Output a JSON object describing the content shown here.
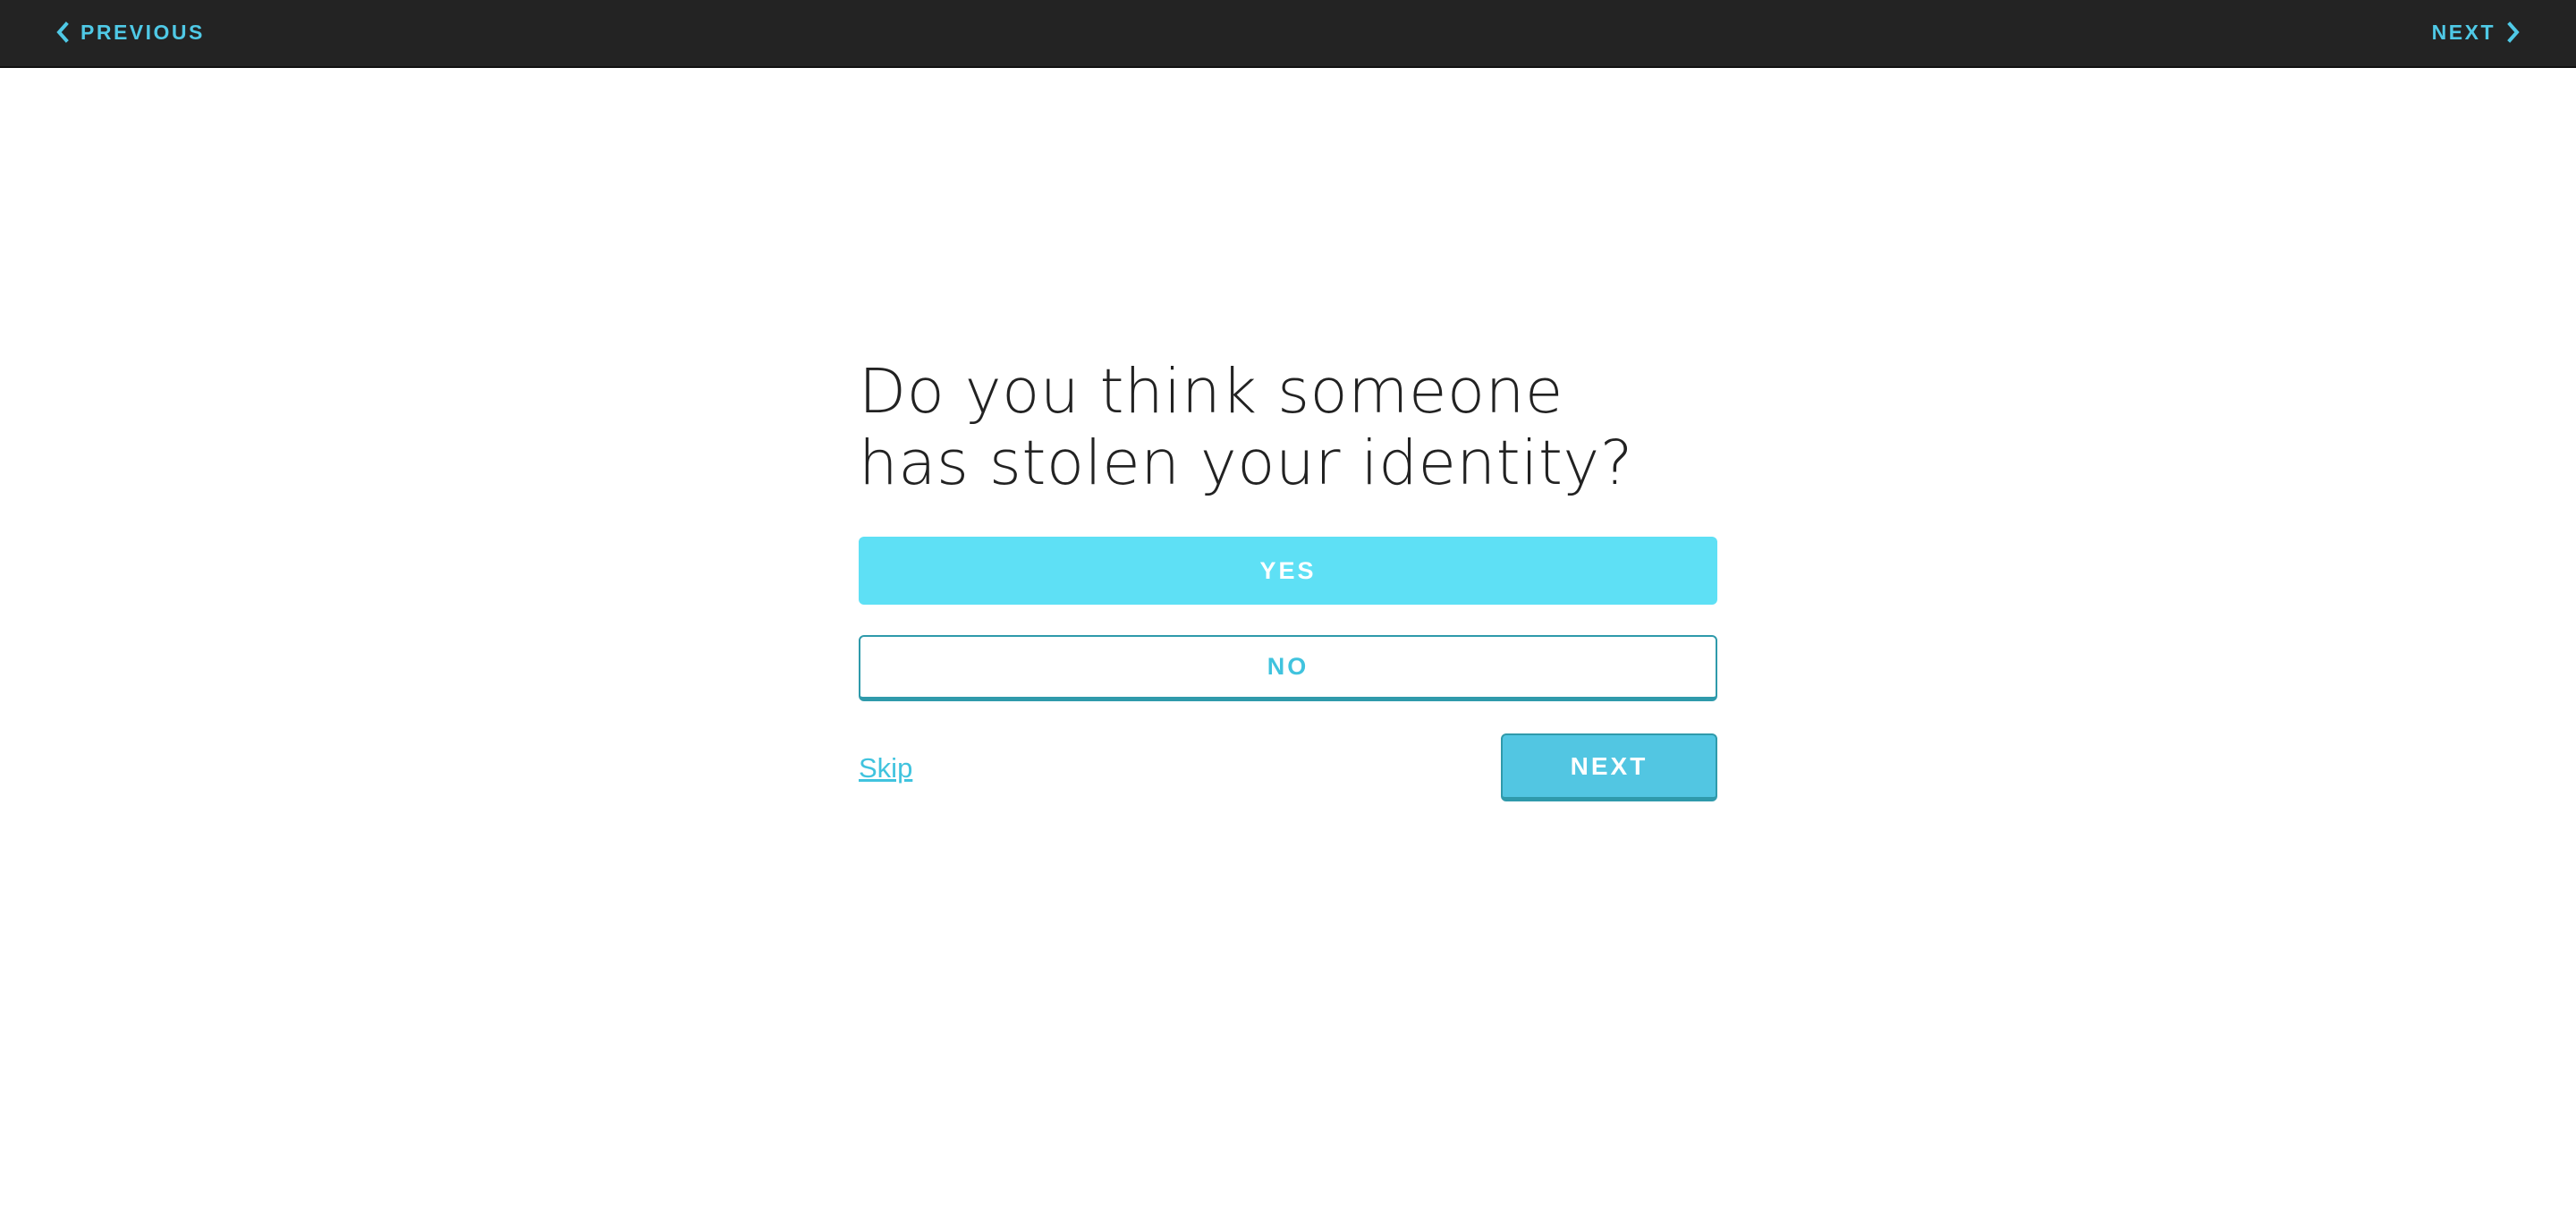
{
  "topbar": {
    "previous_label": "PREVIOUS",
    "next_label": "NEXT",
    "previous_icon": "chevron-left-icon",
    "next_icon": "chevron-right-icon"
  },
  "question": {
    "line1": "Do you think someone",
    "line2": "has stolen your identity?"
  },
  "answers": {
    "yes_label": "YES",
    "no_label": "NO"
  },
  "actions": {
    "skip_label": "Skip",
    "next_label": "NEXT"
  },
  "colors": {
    "topbar_bg": "#232323",
    "accent": "#4fc9e6",
    "yes_bg": "#5ee0f5",
    "next_bg": "#52c6e2",
    "border_teal": "#2f9aab",
    "text_dark": "#222222"
  }
}
